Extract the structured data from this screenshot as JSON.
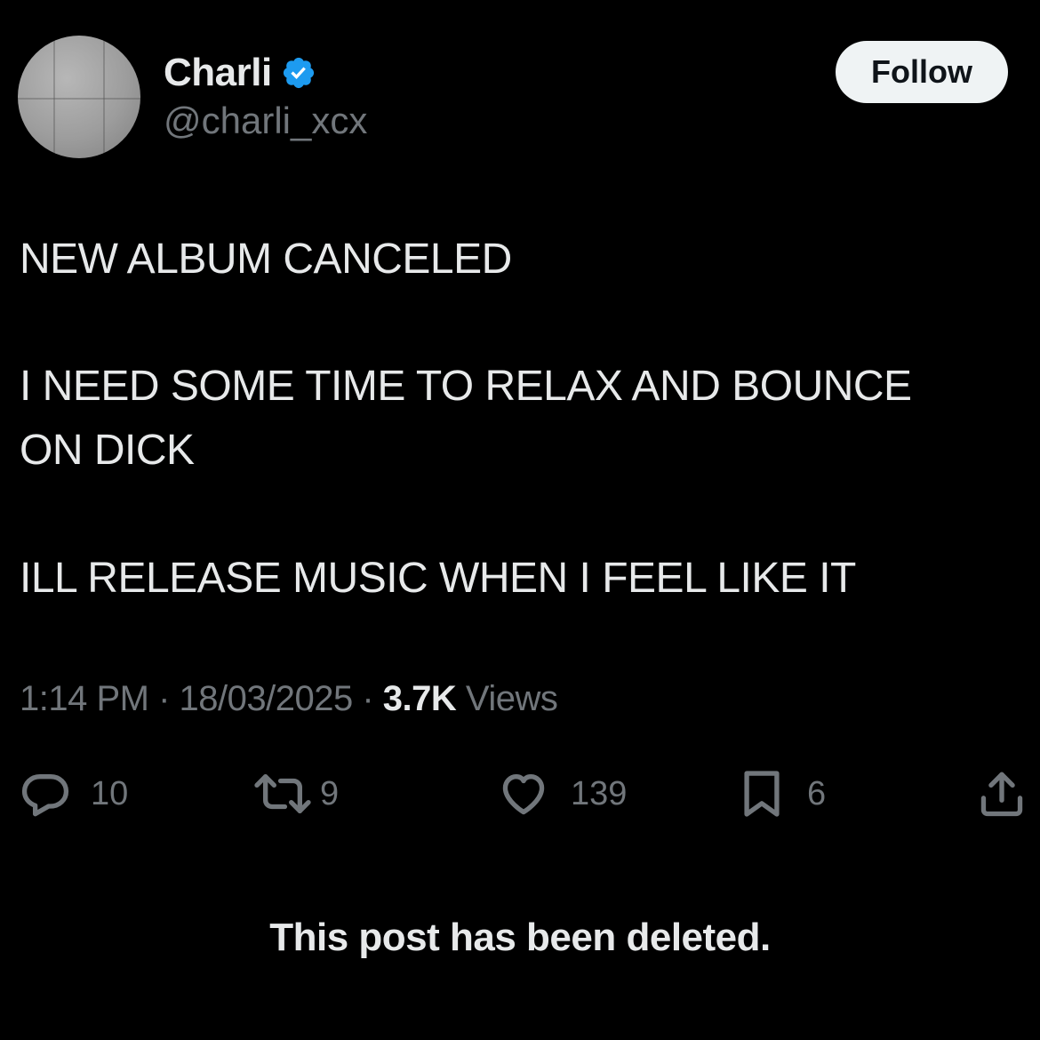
{
  "author": {
    "display_name": "Charli",
    "handle": "@charli_xcx",
    "verified_icon": "verified-badge-icon",
    "verified_color": "#1d9bf0"
  },
  "follow_button": {
    "label": "Follow"
  },
  "post": {
    "lines": [
      "NEW ALBUM CANCELED",
      "I NEED SOME TIME TO RELAX AND BOUNCE",
      "ON DICK",
      "ILL RELEASE MUSIC WHEN I FEEL LIKE IT"
    ]
  },
  "meta": {
    "time": "1:14 PM",
    "separator": "·",
    "date": "18/03/2025",
    "views_count": "3.7K",
    "views_label": "Views"
  },
  "actions": {
    "reply": {
      "icon": "reply-icon",
      "count": "10"
    },
    "repost": {
      "icon": "repost-icon",
      "count": "9"
    },
    "like": {
      "icon": "heart-icon",
      "count": "139"
    },
    "bookmark": {
      "icon": "bookmark-icon",
      "count": "6"
    },
    "share": {
      "icon": "share-icon"
    }
  },
  "notice": {
    "text": "This post has been deleted."
  },
  "colors": {
    "background": "#000000",
    "text_primary": "#e7e9ea",
    "text_secondary": "#71767b",
    "follow_bg": "#eff3f4"
  }
}
